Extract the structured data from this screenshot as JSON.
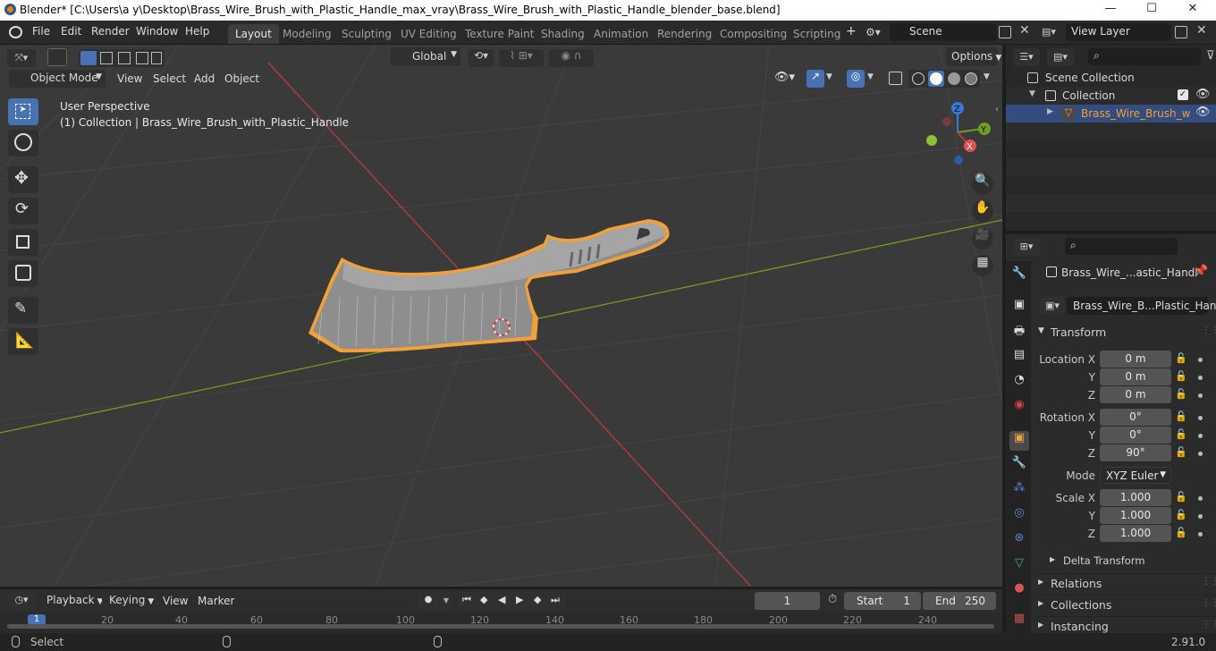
{
  "titlebar": {
    "title": "Blender* [C:\\Users\\a y\\Desktop\\Brass_Wire_Brush_with_Plastic_Handle_max_vray\\Brass_Wire_Brush_with_Plastic_Handle_blender_base.blend]",
    "minimize": "—",
    "maximize": "☐",
    "close": "✕"
  },
  "menubar": {
    "file": "File",
    "edit": "Edit",
    "render": "Render",
    "window": "Window",
    "help": "Help"
  },
  "workspaces": [
    "Layout",
    "Modeling",
    "Sculpting",
    "UV Editing",
    "Texture Paint",
    "Shading",
    "Animation",
    "Rendering",
    "Compositing",
    "Scripting"
  ],
  "workspace_add": "+",
  "scene": {
    "value": "Scene"
  },
  "view_layer": {
    "value": "View Layer"
  },
  "viewport": {
    "mode": "Object Mode",
    "menu_view": "View",
    "menu_select": "Select",
    "menu_add": "Add",
    "menu_object": "Object",
    "transform_orientation": "Global",
    "options": "Options",
    "overlay_line1": "User Perspective",
    "overlay_line2": "(1) Collection | Brass_Wire_Brush_with_Plastic_Handle",
    "gizmo": {
      "x": "X",
      "y": "Y",
      "z": "Z"
    }
  },
  "outliner": {
    "scene_collection": "Scene Collection",
    "collection": "Collection",
    "object": "Brass_Wire_Brush_w"
  },
  "properties": {
    "object_name": "Brass_Wire_...astic_Handl",
    "data_name": "Brass_Wire_B...Plastic_Handle",
    "transform_header": "Transform",
    "location_x_label": "Location X",
    "location_x": "0 m",
    "location_y_label": "Y",
    "location_y": "0 m",
    "location_z_label": "Z",
    "location_z": "0 m",
    "rotation_x_label": "Rotation X",
    "rotation_x": "0°",
    "rotation_y_label": "Y",
    "rotation_y": "0°",
    "rotation_z_label": "Z",
    "rotation_z": "90°",
    "mode_label": "Mode",
    "mode_value": "XYZ Euler",
    "scale_x_label": "Scale X",
    "scale_x": "1.000",
    "scale_y_label": "Y",
    "scale_y": "1.000",
    "scale_z_label": "Z",
    "scale_z": "1.000",
    "delta_transform": "Delta Transform",
    "relations": "Relations",
    "collections": "Collections",
    "instancing": "Instancing"
  },
  "timeline": {
    "playback": "Playback",
    "keying": "Keying",
    "view": "View",
    "marker": "Marker",
    "current_frame": "1",
    "start_label": "Start",
    "start_value": "1",
    "end_label": "End",
    "end_value": "250",
    "ruler": [
      "1",
      "20",
      "40",
      "60",
      "80",
      "100",
      "120",
      "140",
      "160",
      "180",
      "200",
      "220",
      "240"
    ]
  },
  "statusbar": {
    "left": "Select",
    "version": "2.91.0"
  },
  "colors": {
    "accent": "#4772b3",
    "selection_outline": "#f2a13a",
    "axis_x": "#c0393a",
    "axis_y": "#6f9e22"
  }
}
